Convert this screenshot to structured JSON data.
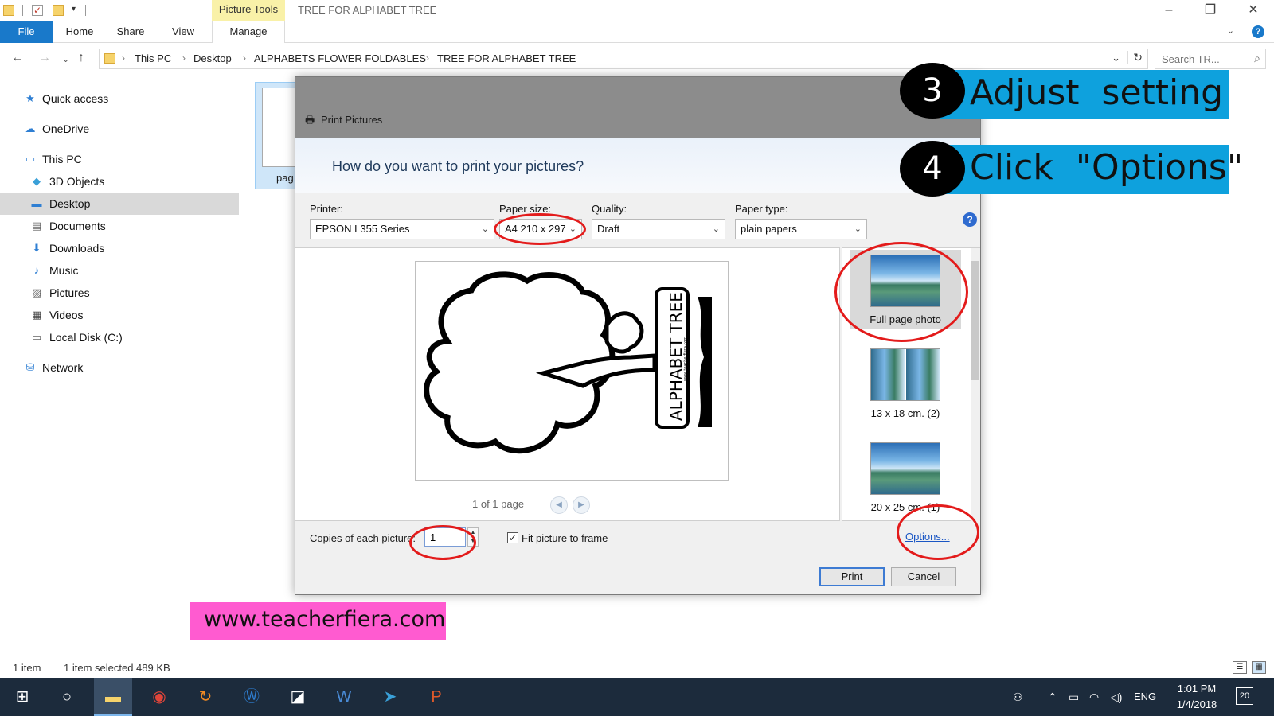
{
  "titlebar": {
    "contextual_tab": "Picture Tools",
    "title": "TREE FOR ALPHABET TREE",
    "controls": [
      "minimize-icon",
      "restore-icon",
      "close-icon"
    ]
  },
  "ribbon": {
    "tabs": [
      "File",
      "Home",
      "Share",
      "View",
      "Manage"
    ],
    "help_label": "?"
  },
  "address": {
    "breadcrumbs": [
      "This PC",
      "Desktop",
      "ALPHABETS FLOWER FOLDABLES",
      "TREE FOR ALPHABET TREE"
    ],
    "search_placeholder": "Search TR..."
  },
  "sidebar": {
    "items": [
      {
        "label": "Quick access",
        "icon": "star-icon"
      },
      {
        "label": "OneDrive",
        "icon": "cloud-icon"
      },
      {
        "label": "This PC",
        "icon": "computer-icon"
      },
      {
        "label": "3D Objects",
        "icon": "cube-icon"
      },
      {
        "label": "Desktop",
        "icon": "desktop-icon",
        "selected": true
      },
      {
        "label": "Documents",
        "icon": "document-icon"
      },
      {
        "label": "Downloads",
        "icon": "download-icon"
      },
      {
        "label": "Music",
        "icon": "music-icon"
      },
      {
        "label": "Pictures",
        "icon": "pictures-icon"
      },
      {
        "label": "Videos",
        "icon": "video-icon"
      },
      {
        "label": "Local Disk (C:)",
        "icon": "disk-icon"
      },
      {
        "label": "Network",
        "icon": "network-icon"
      }
    ]
  },
  "file": {
    "label": "pag"
  },
  "status": {
    "count": "1 item",
    "selected": "1 item selected  489 KB"
  },
  "dialog": {
    "title": "Print Pictures",
    "question": "How do you want to print your pictures?",
    "printer_label": "Printer:",
    "printer_value": "EPSON L355 Series",
    "paper_size_label": "Paper size:",
    "paper_size_value": "A4 210 x 297",
    "quality_label": "Quality:",
    "quality_value": "Draft",
    "paper_type_label": "Paper type:",
    "paper_type_value": "plain papers",
    "help": "?",
    "preview_text": "ALPHABET TREE",
    "preview_url": "www.teacherfiera.com",
    "page_count": "1 of 1 page",
    "layouts": [
      {
        "label": "Full page photo",
        "selected": true
      },
      {
        "label": "13 x 18 cm. (2)"
      },
      {
        "label": "20 x 25 cm. (1)"
      }
    ],
    "copies_label": "Copies of each picture:",
    "copies_value": "1",
    "fit_label": "Fit picture to frame",
    "fit_checked": true,
    "options_link": "Options...",
    "print_button": "Print",
    "cancel_button": "Cancel"
  },
  "overlays": {
    "step3_number": "3",
    "step3_text": "Adjust  setting",
    "step4_number": "4",
    "step4_text": "Click  \"Options\"",
    "watermark": "www.teacherfiera.com",
    "banner_color": "#0ea1dd",
    "ring_color": "#e31b1b",
    "watermark_color": "#ff5bd0"
  },
  "taskbar": {
    "apps": [
      "start-icon",
      "search-circle-icon",
      "file-explorer-icon",
      "chrome-icon",
      "sync-icon",
      "w-app-icon",
      "sticky-notes-icon",
      "word-icon",
      "telegram-icon",
      "powerpoint-icon"
    ],
    "language": "ENG",
    "time": "1:01 PM",
    "date": "1/4/2018",
    "notifications": "20"
  }
}
